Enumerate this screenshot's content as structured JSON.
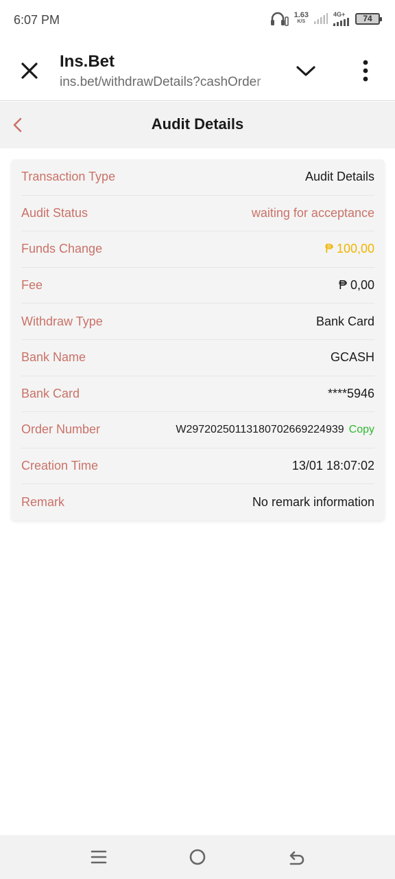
{
  "status_bar": {
    "time": "6:07 PM",
    "speed_value": "1.63",
    "speed_unit": "K/S",
    "network": "4G+",
    "battery": "74"
  },
  "browser": {
    "title": "Ins.Bet",
    "url": "ins.bet/withdrawDetails?cashOrder"
  },
  "page": {
    "title": "Audit Details"
  },
  "details": [
    {
      "label": "Transaction Type",
      "value": "Audit Details"
    },
    {
      "label": "Audit Status",
      "value": "waiting for acceptance"
    },
    {
      "label": "Funds Change",
      "value": "₱ 100,00"
    },
    {
      "label": "Fee",
      "value": "₱ 0,00"
    },
    {
      "label": "Withdraw Type",
      "value": "Bank Card"
    },
    {
      "label": "Bank Name",
      "value": "GCASH"
    },
    {
      "label": "Bank Card",
      "value": "****5946"
    },
    {
      "label": "Order Number",
      "value": "W29720250113180702669224939",
      "action": "Copy"
    },
    {
      "label": "Creation Time",
      "value": "13/01 18:07:02"
    },
    {
      "label": "Remark",
      "value": "No remark information"
    }
  ],
  "colors": {
    "label": "#c97268",
    "status": "#c97268",
    "funds": "#f0b400",
    "copy": "#2fb82f"
  },
  "icons": {
    "close": "close-icon",
    "chevron": "chevron-down-icon",
    "more": "more-vertical-icon",
    "back": "back-arrow-icon",
    "nav_menu": "menu-icon",
    "nav_home": "home-circle-icon",
    "nav_back": "return-icon"
  }
}
